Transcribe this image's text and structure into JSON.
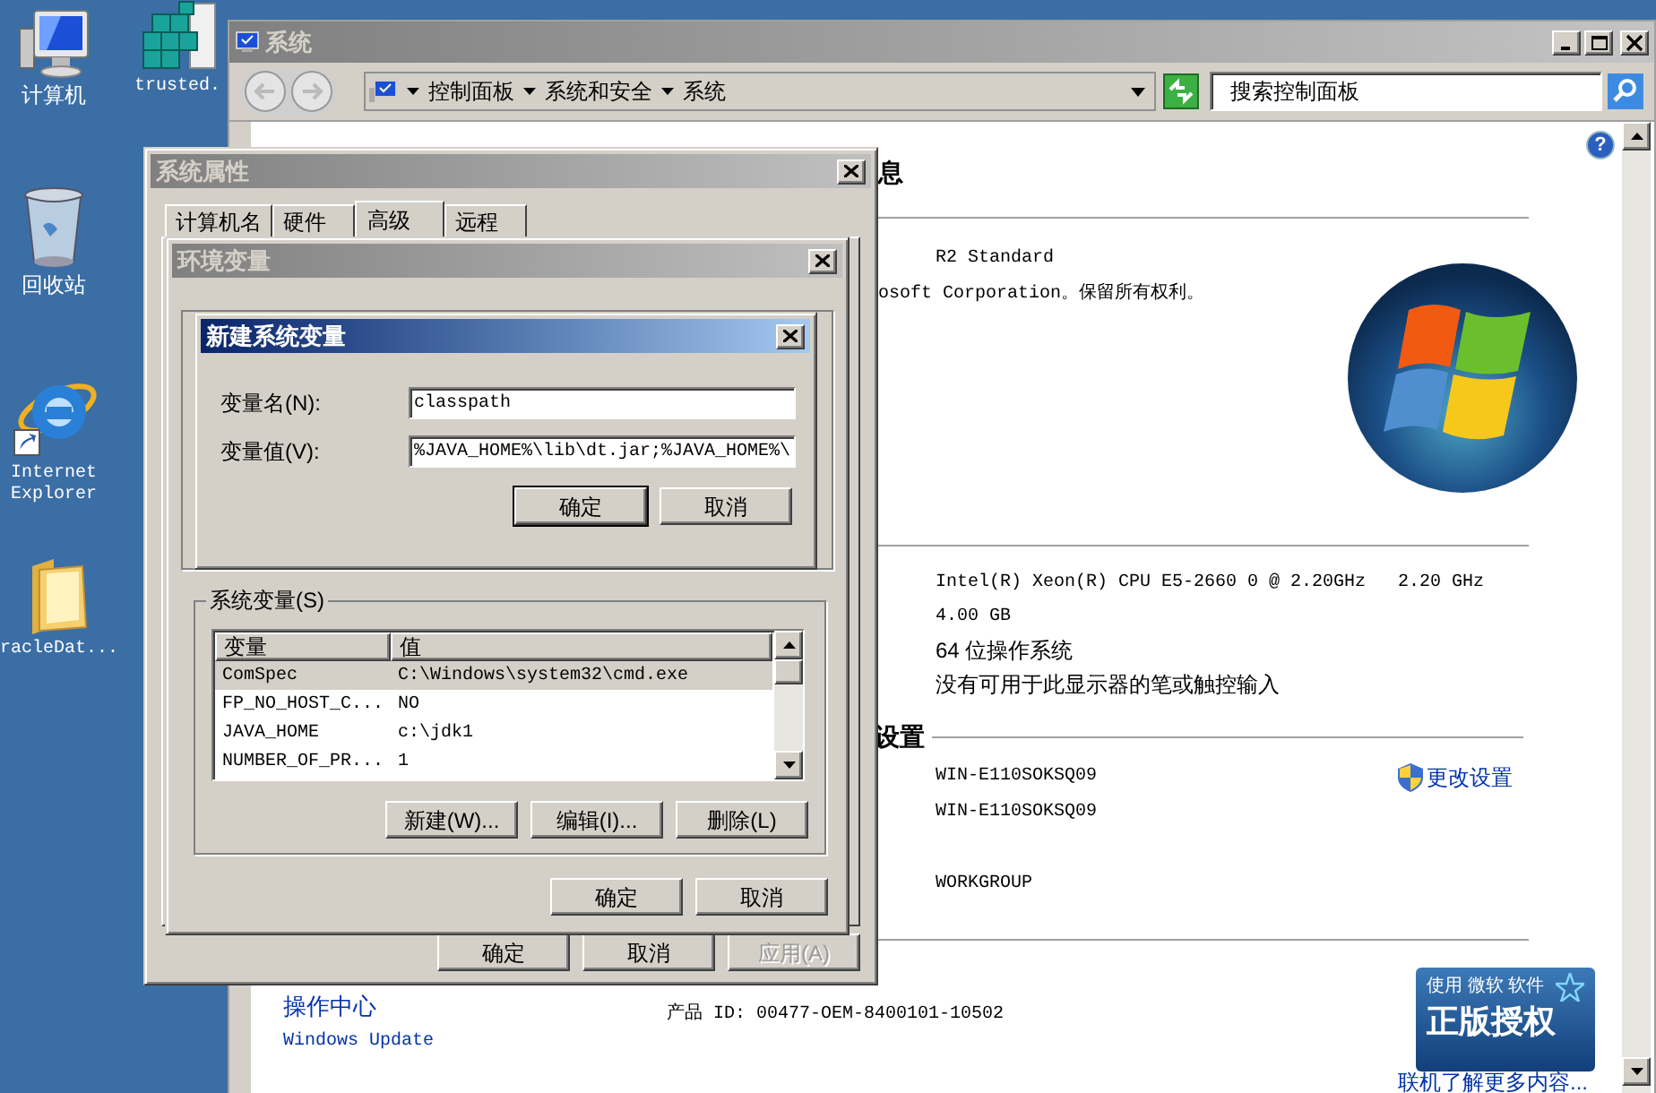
{
  "desktop_icons": [
    {
      "kind": "computer",
      "label": "计算机"
    },
    {
      "kind": "registry",
      "label": "trusted."
    },
    {
      "kind": "recycle_bin",
      "label": "回收站"
    },
    {
      "kind": "browser",
      "label": "Internet Explorer"
    },
    {
      "kind": "folder",
      "label": "racleDat..."
    }
  ],
  "system_window": {
    "title": "系统",
    "breadcrumb": [
      "控制面板",
      "系统和安全",
      "系统"
    ],
    "search": {
      "placeholder": "搜索控制面板"
    },
    "help": "?",
    "heading": "息",
    "edition": "R2 Standard",
    "copyright": "osoft Corporation。保留所有权利。",
    "processor": "Intel(R) Xeon(R) CPU E5-2660 0 @ 2.20GHz",
    "processor_speed": "2.20 GHz",
    "specs": [
      "4.00 GB",
      "64 位操作系统",
      "没有可用于此显示器的笔或触控输入"
    ],
    "settings_heading": "设置",
    "computer_names": [
      "WIN-E110SOKSQ09",
      "WIN-E110SOKSQ09"
    ],
    "change_settings": "更改设置",
    "workgroup": "WORKGROUP",
    "sidebar_links": [
      "操作中心",
      "Windows Update"
    ],
    "product_id": "产品 ID: 00477-OEM-8400101-10502",
    "genuine_badge": {
      "line_1": "使用 微软 软件",
      "line_2": "正版授权"
    },
    "learn_more": "联机了解更多内容..."
  },
  "system_properties": {
    "title": "系统属性",
    "tabs": [
      {
        "label": "计算机名",
        "selected": false
      },
      {
        "label": "硬件",
        "selected": false
      },
      {
        "label": "高级",
        "selected": true
      },
      {
        "label": "远程",
        "selected": false
      }
    ],
    "buttons": [
      {
        "label": "确定",
        "disabled": false
      },
      {
        "label": "取消",
        "disabled": false
      },
      {
        "label": "应用(A)",
        "disabled": true
      }
    ]
  },
  "environment_variables": {
    "title": "环境变量",
    "system_variables": {
      "label": "系统变量(S)",
      "columns": [
        "变量",
        "值"
      ],
      "rows": [
        {
          "name": "ComSpec",
          "value": "C:\\Windows\\system32\\cmd.exe",
          "selected": true
        },
        {
          "name": "FP_NO_HOST_C...",
          "value": "NO",
          "selected": false
        },
        {
          "name": "JAVA_HOME",
          "value": "c:\\jdk1",
          "selected": false
        },
        {
          "name": "NUMBER_OF_PR...",
          "value": "1",
          "selected": false
        }
      ]
    },
    "actions": [
      "新建(W)...",
      "编辑(I)...",
      "删除(L)"
    ],
    "buttons": [
      "确定",
      "取消"
    ]
  },
  "new_system_variable": {
    "title": "新建系统变量",
    "fields": [
      {
        "label": "变量名(N):",
        "value": "classpath"
      },
      {
        "label": "变量值(V):",
        "value": "%JAVA_HOME%\\lib\\dt.jar;%JAVA_HOME%\\"
      }
    ],
    "buttons": [
      {
        "label": "确定",
        "default": true
      },
      {
        "label": "取消",
        "default": false
      }
    ]
  }
}
